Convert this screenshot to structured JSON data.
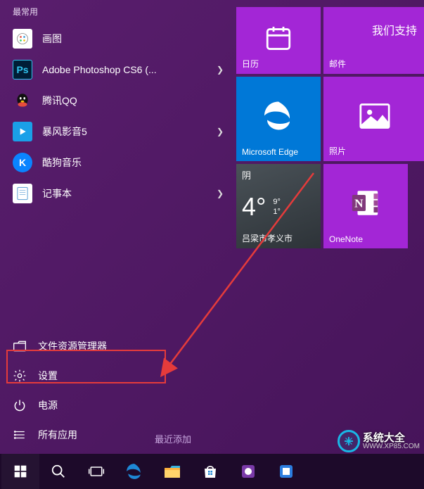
{
  "section_most_used": "最常用",
  "apps": [
    {
      "label": "画图",
      "icon_bg": "#ffffff",
      "icon_name": "paint-icon"
    },
    {
      "label": "Adobe Photoshop CS6 (...",
      "icon_bg": "#001d36",
      "icon_name": "photoshop-icon",
      "icon_text": "Ps",
      "chevron": true
    },
    {
      "label": "腾讯QQ",
      "icon_bg": "transparent",
      "icon_name": "qq-icon"
    },
    {
      "label": "暴风影音5",
      "icon_bg": "#1aa0e8",
      "icon_name": "baofeng-icon",
      "chevron": true
    },
    {
      "label": "酷狗音乐",
      "icon_bg": "#0a84ff",
      "icon_name": "kugou-icon",
      "icon_text": "K"
    },
    {
      "label": "记事本",
      "icon_bg": "#ffffff",
      "icon_name": "notepad-icon",
      "chevron": true
    }
  ],
  "sys_items": [
    {
      "label": "文件资源管理器",
      "icon": "file-explorer-icon"
    },
    {
      "label": "设置",
      "icon": "settings-icon"
    },
    {
      "label": "电源",
      "icon": "power-icon"
    },
    {
      "label": "所有应用",
      "icon": "all-apps-icon"
    }
  ],
  "recent_added": "最近添加",
  "tiles": {
    "calendar": {
      "label": "日历",
      "bg": "#a326d6"
    },
    "mail": {
      "label": "邮件",
      "bg": "#a326d6"
    },
    "edge": {
      "label": "Microsoft Edge",
      "bg": "#0078d7"
    },
    "photos": {
      "label": "照片",
      "bg": "#a326d6"
    },
    "weather": {
      "condition": "阴",
      "temp": "4°",
      "high": "9°",
      "low": "1°",
      "location": "吕梁市孝义市",
      "bg": "#3a3f44"
    },
    "onenote": {
      "label": "OneNote",
      "bg": "#a326d6"
    }
  },
  "right_header": "我们支持",
  "watermark": {
    "name": "系统大全",
    "url": "WWW.XP85.COM"
  }
}
